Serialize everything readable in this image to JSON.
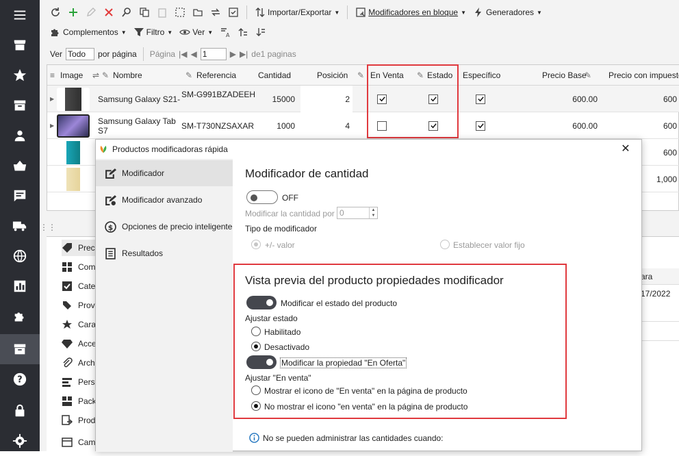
{
  "toolbar1": {
    "import_export": "Importar/Exportar",
    "bulk_modifiers": "Modificadores en bloque",
    "generators": "Generadores"
  },
  "toolbar2": {
    "addons": "Complementos",
    "filter": "Filtro",
    "view": "Ver"
  },
  "pager": {
    "show_label": "Ver",
    "show_value": "Todo",
    "per_page": "por página",
    "page_label": "Página",
    "page_value": "1",
    "of_pages": "de1 paginas"
  },
  "grid": {
    "columns": [
      "Image",
      "Nombre",
      "Referencia",
      "Cantidad",
      "Posición",
      "En Venta",
      "Estado",
      "Específico",
      "Precio Base",
      "Precio con impuesto"
    ],
    "rows": [
      {
        "name": "Samsung Galaxy S21-",
        "name2": "",
        "ref": "SM-G991BZADEEH",
        "qty": "15000",
        "pos": "2",
        "on_sale": true,
        "status": true,
        "specific": true,
        "base": "600.00",
        "tax": "600"
      },
      {
        "name": "Samsung Galaxy Tab",
        "name2": "S7",
        "ref": "SM-T730NZSAXAR",
        "qty": "1000",
        "pos": "4",
        "on_sale": false,
        "status": true,
        "specific": true,
        "base": "600.00",
        "tax": "600"
      },
      {
        "name": "",
        "name2": "",
        "ref": "",
        "qty": "",
        "pos": "",
        "base": "",
        "tax": "600"
      },
      {
        "name": "",
        "name2": "",
        "ref": "",
        "qty": "",
        "pos": "",
        "base": "",
        "tax": "1,000"
      }
    ]
  },
  "lower_panel": {
    "items": [
      "Preci",
      "Comb",
      "Categ",
      "Prove",
      "Carac",
      "Acces",
      "Archi",
      "Perso",
      "Pack",
      "Prod",
      "Camp"
    ],
    "right_header": "ara",
    "right_value": "17/2022"
  },
  "dialog": {
    "title": "Productos modificadoras rápida",
    "nav": [
      "Modificador",
      "Modificador avanzado",
      "Opciones de precio inteligente",
      "Resultados"
    ],
    "qty_section_title": "Modificador de cantidad",
    "toggle_off_label": "OFF",
    "modify_qty_label": "Modificar la cantidad por",
    "modify_qty_value": "0",
    "modifier_type_label": "Tipo de modificador",
    "radio_plus_minus": "+/- valor",
    "radio_fixed": "Establecer valor fijo",
    "preview_title": "Vista previa del producto propiedades modificador",
    "modify_status": "Modificar el estado del producto",
    "adjust_status": "Ajustar estado",
    "enabled": "Habilitado",
    "disabled": "Desactivado",
    "modify_on_sale": "Modificar la propiedad \"En Oferta\"",
    "adjust_on_sale": "Ajustar \"En venta\"",
    "show_icon": "Mostrar el icono de \"En venta\" en la página de producto",
    "hide_icon": "No mostrar el icono \"en venta\" en la página de producto",
    "info_text": "No se pueden administrar las cantidades cuando:"
  },
  "colors": {
    "sidebar": "#2b2d33",
    "highlight": "#e0393e",
    "toggle_on": "#45474e",
    "info_icon": "#1e73be"
  }
}
